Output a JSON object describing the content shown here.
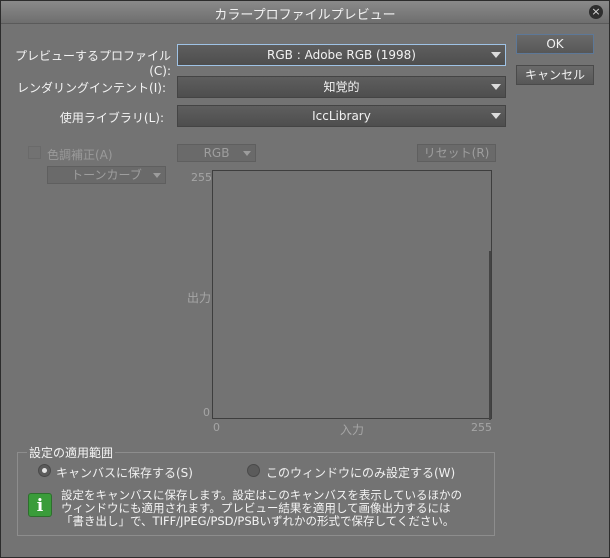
{
  "window": {
    "title": "カラープロファイルプレビュー",
    "close_symbol": "×"
  },
  "form": {
    "preview_profile": {
      "label": "プレビューするプロファイル(C):",
      "value": "RGB : Adobe RGB (1998)"
    },
    "rendering_intent": {
      "label": "レンダリングインテント(I):",
      "value": "知覚的"
    },
    "library": {
      "label": "使用ライブラリ(L):",
      "value": "IccLibrary"
    }
  },
  "buttons": {
    "ok": "OK",
    "cancel": "キャンセル"
  },
  "tone": {
    "checkbox_label": "色調補正(A)",
    "checked": false,
    "channel": "RGB",
    "reset": "リセット(R)",
    "curve": "トーンカーブ"
  },
  "graph": {
    "y_max": "255",
    "y_min": "0",
    "y_label": "出力",
    "x_min": "0",
    "x_max": "255",
    "x_label": "入力"
  },
  "scope": {
    "title": "設定の適用範囲",
    "options": [
      {
        "label": "キャンバスに保存する(S)",
        "selected": true
      },
      {
        "label": "このウィンドウにのみ設定する(W)",
        "selected": false
      }
    ],
    "info_icon": "info-icon",
    "info_lines": [
      "設定をキャンバスに保存します。設定はこのキャンバスを表示しているほかの",
      "ウィンドウにも適用されます。プレビュー結果を適用して画像出力するには",
      "「書き出し」で、TIFF/JPEG/PSD/PSBいずれかの形式で保存してください。"
    ]
  }
}
